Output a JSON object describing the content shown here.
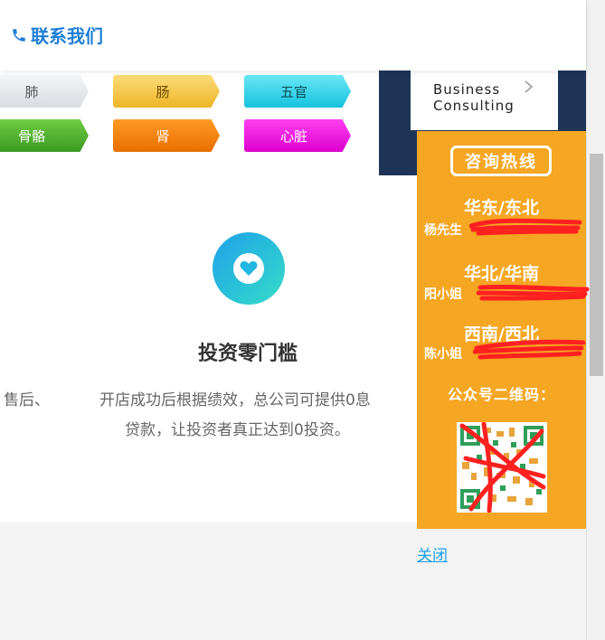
{
  "header": {
    "contact_label": "联系我们"
  },
  "tags": [
    {
      "label": "肺",
      "bg": "#e6e8eb",
      "fg": "#555555"
    },
    {
      "label": "肠",
      "bg": "#f4c84a",
      "fg": "#6b4a00"
    },
    {
      "label": "五官",
      "bg": "#2ad3ea",
      "fg": "#0b4e5a"
    },
    {
      "label": "骨骼",
      "bg": "#4caf2f",
      "fg": "#ffffff"
    },
    {
      "label": "肾",
      "bg": "#f38211",
      "fg": "#ffffff"
    },
    {
      "label": "心脏",
      "bg": "#ee16e0",
      "fg": "#ffffff"
    }
  ],
  "consulting_card": {
    "line1": "Business",
    "line2": "Consulting"
  },
  "feature": {
    "icon": "heart-icon",
    "title": "投资零门槛",
    "desc_left": "售后、",
    "desc_line1": "开店成功后根据绩效，总公司可提供0息",
    "desc_line2": "贷款，让投资者真正达到0投资。"
  },
  "hotline": {
    "title": "咨询热线",
    "regions": [
      {
        "name": "华东/东北",
        "person": "杨先生"
      },
      {
        "name": "华北/华南",
        "person": "阳小姐"
      },
      {
        "name": "西南/西北",
        "person": "陈小姐"
      }
    ],
    "qr_label": "公众号二维码：",
    "bg": "#f5a623"
  },
  "close_label": "关闭",
  "colors": {
    "link": "#1aa0e8",
    "accent": "#1f7fd6",
    "navy": "#1e3457",
    "scribble": "#ff2020"
  }
}
